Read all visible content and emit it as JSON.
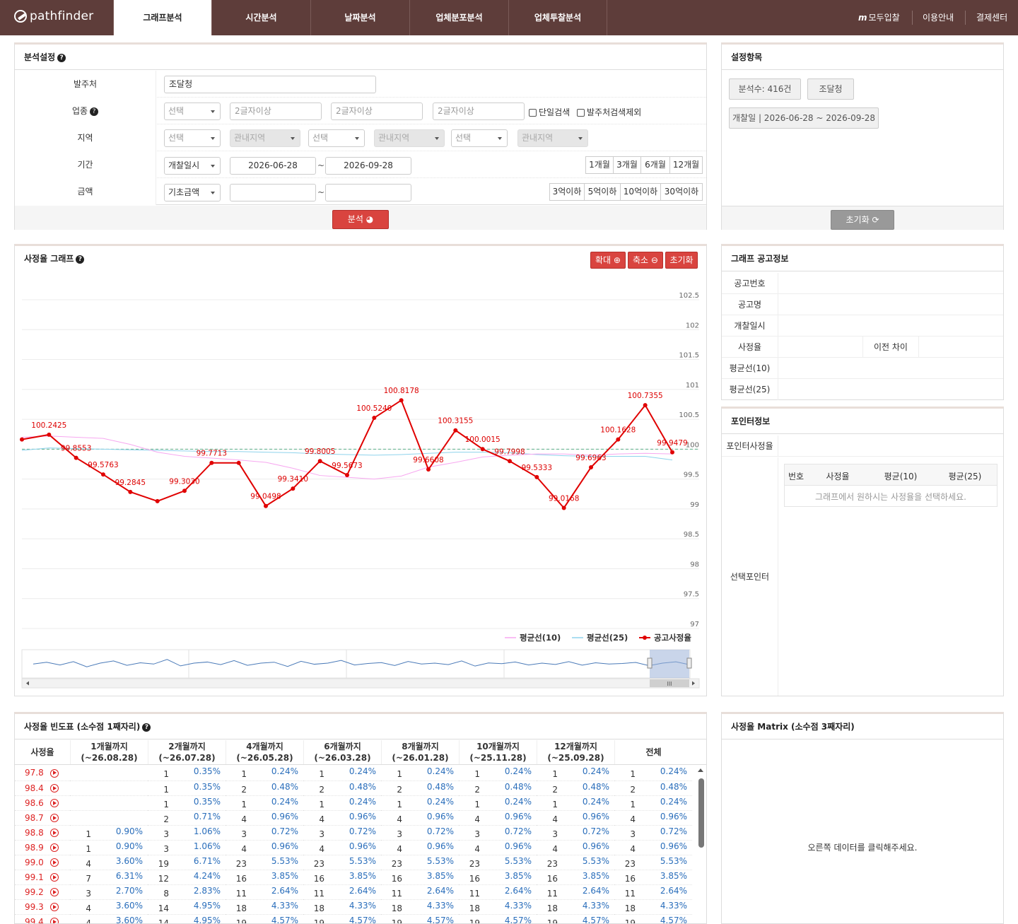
{
  "brand": {
    "name": "pathfinder"
  },
  "nav": {
    "tabs": [
      {
        "label": "그래프분석",
        "active": true
      },
      {
        "label": "시간분석"
      },
      {
        "label": "날짜분석"
      },
      {
        "label": "업체분포분석"
      },
      {
        "label": "업체투찰분석"
      }
    ],
    "right": {
      "logo_letter": "m",
      "modu": "모두입찰",
      "guide": "이용안내",
      "pay": "결제센터"
    }
  },
  "settings": {
    "title": "분석설정",
    "client": {
      "label": "발주처",
      "value": "조달청"
    },
    "industry": {
      "label": "업종",
      "select": "선택",
      "placeholders": [
        "2글자이상",
        "2글자이상",
        "2글자이상"
      ],
      "single": "단일검색",
      "exclude": "발주처검색제외"
    },
    "region": {
      "label": "지역",
      "selects": [
        "선택",
        "관내지역",
        "선택",
        "관내지역",
        "선택",
        "관내지역"
      ]
    },
    "period": {
      "label": "기간",
      "type": "개찰일시",
      "from": "2026-06-28",
      "tilde": "~",
      "to": "2026-09-28",
      "quick": [
        "1개월",
        "3개월",
        "6개월",
        "12개월"
      ]
    },
    "amount": {
      "label": "금액",
      "type": "기초금액",
      "tilde": "~",
      "quick": [
        "3억이하",
        "5억이하",
        "10억이하",
        "30억이하"
      ]
    },
    "analyze": "분석"
  },
  "config": {
    "title": "설정항목",
    "count": "분석수: 416건",
    "client": "조달청",
    "date": "개찰일 | 2026-06-28 ~ 2026-09-28",
    "reset": "초기화"
  },
  "graph": {
    "title": "사정율 그래프",
    "zoom_in": "확대",
    "zoom_out": "축소",
    "reset": "초기화",
    "scrollbar_grip": "III"
  },
  "chart_data": {
    "type": "line",
    "ylim": [
      97,
      102.5
    ],
    "yticks": [
      "102.5",
      "102",
      "101.5",
      "101",
      "100.5",
      "100",
      "99.5",
      "99",
      "98.5",
      "98",
      "97.5",
      "97"
    ],
    "series": [
      {
        "name": "공고사정율",
        "color": "#e00000",
        "values": [
          100.1628,
          100.2425,
          99.8553,
          99.5763,
          99.2845,
          99.13,
          99.303,
          99.7713,
          99.77,
          99.0498,
          99.341,
          99.8005,
          99.5673,
          100.524,
          100.8178,
          99.6608,
          100.3155,
          100.0015,
          99.7998,
          99.5333,
          99.0168,
          99.6963,
          100.1628,
          100.7355,
          99.9479
        ],
        "labels": [
          "",
          "100.2425",
          "99.8553",
          "99.5763",
          "99.2845",
          "",
          "99.3030",
          "99.7713",
          "",
          "99.0498",
          "99.3410",
          "99.8005",
          "99.5673",
          "100.5240",
          "100.8178",
          "99.6608",
          "100.3155",
          "100.0015",
          "99.7998",
          "99.5333",
          "99.0168",
          "99.6963",
          "100.1628",
          "100.7355",
          "99.9479"
        ]
      },
      {
        "name": "평균선(10)",
        "color": "#f7a8f0",
        "values": [
          100.2,
          100.22,
          100.2,
          100.18,
          100.08,
          99.95,
          99.88,
          99.85,
          99.82,
          99.78,
          99.68,
          99.56,
          99.53,
          99.5,
          99.55,
          99.7,
          99.78,
          99.87,
          99.9,
          99.92,
          99.92,
          99.9,
          99.92,
          99.93,
          99.92
        ]
      },
      {
        "name": "평균선(25)",
        "color": "#8fd3ec",
        "values": [
          99.98,
          100.02,
          100.01,
          100.0,
          99.99,
          99.98,
          99.97,
          99.96,
          99.96,
          99.95,
          99.94,
          99.92,
          99.91,
          99.9,
          99.91,
          99.93,
          99.95,
          99.95,
          99.94,
          99.91,
          99.89,
          99.88,
          99.88,
          99.88,
          99.82
        ]
      }
    ],
    "reference": 100,
    "overview": [
      0.55,
      0.45,
      0.6,
      0.42,
      0.7,
      0.5,
      0.38,
      0.62,
      0.48,
      0.55,
      0.3,
      0.65,
      0.5,
      0.44,
      0.58,
      0.36,
      0.62,
      0.5,
      0.45,
      0.68,
      0.4,
      0.56,
      0.5,
      0.35,
      0.6,
      0.52,
      0.47,
      0.63,
      0.41,
      0.55,
      0.5,
      0.58,
      0.38,
      0.66,
      0.49,
      0.53,
      0.44,
      0.6,
      0.5,
      0.57,
      0.42,
      0.61,
      0.48,
      0.55,
      0.52,
      0.46,
      0.64,
      0.5,
      0.43,
      0.58
    ]
  },
  "notice": {
    "title": "그래프 공고정보",
    "rows": [
      "공고번호",
      "공고명",
      "개찰일시",
      "사정율",
      "평균선(10)",
      "평균선(25)"
    ],
    "diff": "이전 차이"
  },
  "pointer": {
    "title": "포인터정보",
    "rate_label": "포인터사정율",
    "sel_label": "선택포인터",
    "cols": [
      "번호",
      "사정율",
      "평균(10)",
      "평균(25)"
    ],
    "empty": "그래프에서 원하시는 사정율을 선택하세요."
  },
  "freq": {
    "title": "사정율 빈도표 (소수점 1째자리)",
    "headers": [
      [
        "사정율",
        ""
      ],
      [
        "1개월까지",
        "(~26.08.28)"
      ],
      [
        "2개월까지",
        "(~26.07.28)"
      ],
      [
        "4개월까지",
        "(~26.05.28)"
      ],
      [
        "6개월까지",
        "(~26.03.28)"
      ],
      [
        "8개월까지",
        "(~26.01.28)"
      ],
      [
        "10개월까지",
        "(~25.11.28)"
      ],
      [
        "12개월까지",
        "(~25.09.28)"
      ],
      [
        "전체",
        ""
      ]
    ],
    "rows": [
      {
        "v": "97.8",
        "c": [
          [
            "",
            ""
          ],
          [
            "1",
            "0.35%"
          ],
          [
            "1",
            "0.24%"
          ],
          [
            "1",
            "0.24%"
          ],
          [
            "1",
            "0.24%"
          ],
          [
            "1",
            "0.24%"
          ],
          [
            "1",
            "0.24%"
          ],
          [
            "1",
            "0.24%"
          ]
        ]
      },
      {
        "v": "98.4",
        "c": [
          [
            "",
            ""
          ],
          [
            "1",
            "0.35%"
          ],
          [
            "2",
            "0.48%"
          ],
          [
            "2",
            "0.48%"
          ],
          [
            "2",
            "0.48%"
          ],
          [
            "2",
            "0.48%"
          ],
          [
            "2",
            "0.48%"
          ],
          [
            "2",
            "0.48%"
          ]
        ]
      },
      {
        "v": "98.6",
        "c": [
          [
            "",
            ""
          ],
          [
            "1",
            "0.35%"
          ],
          [
            "1",
            "0.24%"
          ],
          [
            "1",
            "0.24%"
          ],
          [
            "1",
            "0.24%"
          ],
          [
            "1",
            "0.24%"
          ],
          [
            "1",
            "0.24%"
          ],
          [
            "1",
            "0.24%"
          ]
        ]
      },
      {
        "v": "98.7",
        "c": [
          [
            "",
            ""
          ],
          [
            "2",
            "0.71%"
          ],
          [
            "4",
            "0.96%"
          ],
          [
            "4",
            "0.96%"
          ],
          [
            "4",
            "0.96%"
          ],
          [
            "4",
            "0.96%"
          ],
          [
            "4",
            "0.96%"
          ],
          [
            "4",
            "0.96%"
          ]
        ]
      },
      {
        "v": "98.8",
        "c": [
          [
            "1",
            "0.90%"
          ],
          [
            "3",
            "1.06%"
          ],
          [
            "3",
            "0.72%"
          ],
          [
            "3",
            "0.72%"
          ],
          [
            "3",
            "0.72%"
          ],
          [
            "3",
            "0.72%"
          ],
          [
            "3",
            "0.72%"
          ],
          [
            "3",
            "0.72%"
          ]
        ]
      },
      {
        "v": "98.9",
        "c": [
          [
            "1",
            "0.90%"
          ],
          [
            "3",
            "1.06%"
          ],
          [
            "4",
            "0.96%"
          ],
          [
            "4",
            "0.96%"
          ],
          [
            "4",
            "0.96%"
          ],
          [
            "4",
            "0.96%"
          ],
          [
            "4",
            "0.96%"
          ],
          [
            "4",
            "0.96%"
          ]
        ]
      },
      {
        "v": "99.0",
        "c": [
          [
            "4",
            "3.60%"
          ],
          [
            "19",
            "6.71%"
          ],
          [
            "23",
            "5.53%"
          ],
          [
            "23",
            "5.53%"
          ],
          [
            "23",
            "5.53%"
          ],
          [
            "23",
            "5.53%"
          ],
          [
            "23",
            "5.53%"
          ],
          [
            "23",
            "5.53%"
          ]
        ]
      },
      {
        "v": "99.1",
        "c": [
          [
            "7",
            "6.31%"
          ],
          [
            "12",
            "4.24%"
          ],
          [
            "16",
            "3.85%"
          ],
          [
            "16",
            "3.85%"
          ],
          [
            "16",
            "3.85%"
          ],
          [
            "16",
            "3.85%"
          ],
          [
            "16",
            "3.85%"
          ],
          [
            "16",
            "3.85%"
          ]
        ]
      },
      {
        "v": "99.2",
        "c": [
          [
            "3",
            "2.70%"
          ],
          [
            "8",
            "2.83%"
          ],
          [
            "11",
            "2.64%"
          ],
          [
            "11",
            "2.64%"
          ],
          [
            "11",
            "2.64%"
          ],
          [
            "11",
            "2.64%"
          ],
          [
            "11",
            "2.64%"
          ],
          [
            "11",
            "2.64%"
          ]
        ]
      },
      {
        "v": "99.3",
        "c": [
          [
            "4",
            "3.60%"
          ],
          [
            "14",
            "4.95%"
          ],
          [
            "18",
            "4.33%"
          ],
          [
            "18",
            "4.33%"
          ],
          [
            "18",
            "4.33%"
          ],
          [
            "18",
            "4.33%"
          ],
          [
            "18",
            "4.33%"
          ],
          [
            "18",
            "4.33%"
          ]
        ]
      },
      {
        "v": "99.4",
        "c": [
          [
            "4",
            "3.60%"
          ],
          [
            "14",
            "4.95%"
          ],
          [
            "19",
            "4.57%"
          ],
          [
            "19",
            "4.57%"
          ],
          [
            "19",
            "4.57%"
          ],
          [
            "19",
            "4.57%"
          ],
          [
            "19",
            "4.57%"
          ],
          [
            "19",
            "4.57%"
          ]
        ]
      }
    ]
  },
  "matrix": {
    "title": "사정율 Matrix (소수점 3째자리)",
    "hint": "오른쪽 데이터를 클릭해주세요."
  }
}
